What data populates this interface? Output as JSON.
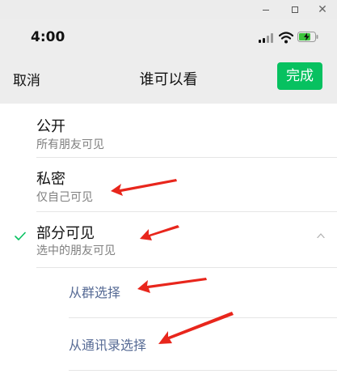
{
  "status_bar": {
    "time": "4:00"
  },
  "nav": {
    "cancel_label": "取消",
    "title": "谁可以看",
    "done_label": "完成"
  },
  "options": [
    {
      "title": "公开",
      "subtitle": "所有朋友可见",
      "selected": false
    },
    {
      "title": "私密",
      "subtitle": "仅自己可见",
      "selected": false
    },
    {
      "title": "部分可见",
      "subtitle": "选中的朋友可见",
      "selected": true,
      "expanded": true
    }
  ],
  "sub_options": [
    {
      "label": "从群选择"
    },
    {
      "label": "从通讯录选择"
    }
  ],
  "icons": {
    "check": "check-icon",
    "chevron": "chevron-up-icon",
    "wifi": "wifi-icon",
    "battery": "battery-charging-icon",
    "signal": "cellular-signal-icon"
  },
  "colors": {
    "accent_green": "#07c160",
    "link_blue": "#576b95",
    "annotation_red": "#e8261c",
    "header_bg": "#ededed"
  }
}
